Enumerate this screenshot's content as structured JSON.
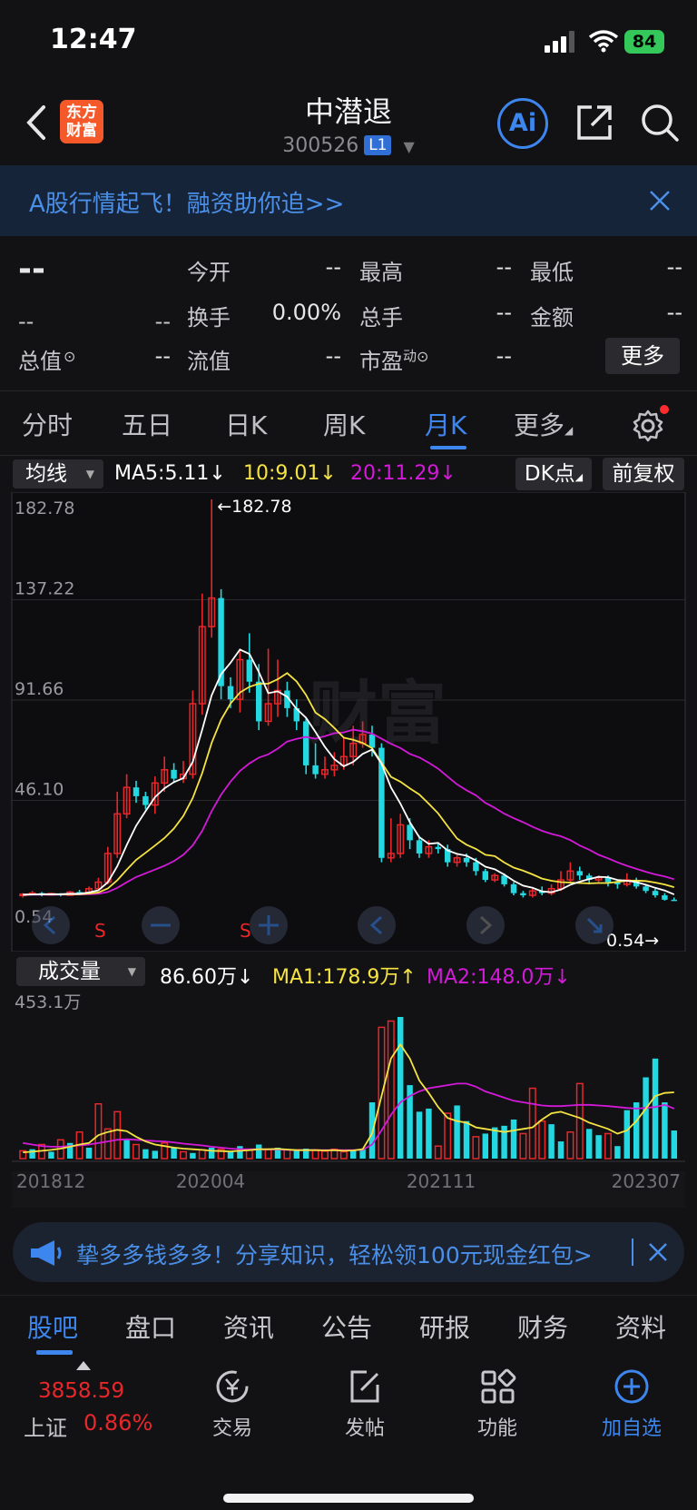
{
  "status_bar": {
    "time": "12:47",
    "battery": "84"
  },
  "header": {
    "logo_line1": "东方",
    "logo_line2": "财富",
    "title": "中潜退",
    "code": "300526",
    "level": "L1",
    "ai_label": "Ai"
  },
  "banner": {
    "text": "A股行情起飞！融资助你追>>"
  },
  "quote": {
    "price": "--",
    "change": "--",
    "change_pct": "--",
    "fields": [
      {
        "label": "今开",
        "value": "--"
      },
      {
        "label": "最高",
        "value": "--"
      },
      {
        "label": "最低",
        "value": "--"
      },
      {
        "label": "换手",
        "value": "0.00%"
      },
      {
        "label": "总手",
        "value": "--"
      },
      {
        "label": "金额",
        "value": "--"
      },
      {
        "label": "总值",
        "value": "--"
      },
      {
        "label": "流值",
        "value": "--"
      },
      {
        "label": "市盈",
        "sup": "动",
        "value": "--"
      }
    ],
    "more": "更多"
  },
  "tabs": [
    "分时",
    "五日",
    "日K",
    "周K",
    "月K",
    "更多"
  ],
  "active_tab": 4,
  "kline_toolbar": {
    "indicator": "均线",
    "ma5": "MA5:5.11↓",
    "ma10": "10:9.01↓",
    "ma20": "20:11.29↓",
    "dk": "DK点",
    "adjust": "前复权"
  },
  "kline_axis": {
    "labels": [
      "182.78",
      "137.22",
      "91.66",
      "46.10",
      "0.54"
    ],
    "max_label": "←182.78",
    "min_label": "0.54→"
  },
  "kline_markers": [
    "S",
    "S"
  ],
  "volume_toolbar": {
    "indicator": "成交量",
    "current": "86.60万↓",
    "ma1": "MA1:178.9万↑",
    "ma2": "MA2:148.0万↓"
  },
  "volume_axis": {
    "max": "453.1万"
  },
  "x_labels": [
    "201812",
    "202004",
    "202111",
    "202307"
  ],
  "colors": {
    "up": "#e8272a",
    "down": "#23d8e0",
    "ma5": "#ffffff",
    "ma10": "#f5e342",
    "ma20": "#d21ad8",
    "accent": "#3d86ee"
  },
  "promo": {
    "text": "挚多多钱多多！分享知识，轻松领100元现金红包>"
  },
  "bottom_tabs": [
    "股吧",
    "盘口",
    "资讯",
    "公告",
    "研报",
    "财务",
    "资料"
  ],
  "active_bottom_tab": 0,
  "dock": {
    "index_value": "3858.59",
    "index_name": "上证",
    "index_pct": "0.86%",
    "items": [
      "交易",
      "发帖",
      "功能",
      "加自选"
    ]
  },
  "chart_data": [
    {
      "type": "candlestick",
      "title": "",
      "ylim": [
        0.54,
        182.78
      ],
      "x_ticks": [
        "201812",
        "202004",
        "202111",
        "202307"
      ],
      "candles": [
        [
          3,
          3.5,
          2,
          4
        ],
        [
          3.5,
          4,
          3,
          5
        ],
        [
          4,
          3.2,
          2.5,
          4.5
        ],
        [
          3.2,
          3.8,
          2.8,
          4.2
        ],
        [
          3.8,
          3,
          2.5,
          4
        ],
        [
          3,
          4.5,
          2.8,
          5
        ],
        [
          4.5,
          4,
          3.5,
          5.5
        ],
        [
          4,
          6,
          3.5,
          7
        ],
        [
          6,
          9,
          5,
          11
        ],
        [
          9,
          22,
          8,
          25
        ],
        [
          22,
          40,
          20,
          50
        ],
        [
          40,
          52,
          38,
          58
        ],
        [
          52,
          48,
          45,
          55
        ],
        [
          48,
          44,
          42,
          50
        ],
        [
          44,
          54,
          40,
          57
        ],
        [
          54,
          60,
          50,
          66
        ],
        [
          60,
          56,
          54,
          63
        ],
        [
          56,
          58,
          54,
          64
        ],
        [
          58,
          90,
          56,
          96
        ],
        [
          90,
          125,
          85,
          140
        ],
        [
          125,
          138,
          120,
          182.78
        ],
        [
          138,
          98,
          92,
          142
        ],
        [
          98,
          92,
          88,
          102
        ],
        [
          92,
          110,
          86,
          115
        ],
        [
          110,
          100,
          95,
          122
        ],
        [
          100,
          82,
          78,
          108
        ],
        [
          82,
          90,
          80,
          115
        ],
        [
          90,
          96,
          84,
          110
        ],
        [
          96,
          88,
          84,
          100
        ],
        [
          88,
          82,
          78,
          92
        ],
        [
          82,
          62,
          58,
          84
        ],
        [
          62,
          58,
          56,
          72
        ],
        [
          58,
          60,
          56,
          66
        ],
        [
          60,
          62,
          57,
          68
        ],
        [
          62,
          66,
          60,
          75
        ],
        [
          66,
          72,
          62,
          80
        ],
        [
          72,
          76,
          70,
          82
        ],
        [
          76,
          70,
          66,
          80
        ],
        [
          70,
          20,
          18,
          72
        ],
        [
          20,
          22,
          18,
          38
        ],
        [
          22,
          35,
          20,
          40
        ],
        [
          35,
          28,
          24,
          38
        ],
        [
          28,
          22,
          20,
          30
        ],
        [
          22,
          25,
          20,
          28
        ],
        [
          25,
          24,
          22,
          27
        ],
        [
          24,
          18,
          16,
          26
        ],
        [
          18,
          20,
          16,
          22
        ],
        [
          20,
          18,
          16,
          22
        ],
        [
          18,
          14,
          12,
          20
        ],
        [
          14,
          10,
          9,
          15
        ],
        [
          10,
          12,
          9,
          13
        ],
        [
          12,
          8,
          7,
          13
        ],
        [
          8,
          4,
          3,
          9
        ],
        [
          4,
          3,
          2,
          5
        ],
        [
          3,
          5,
          2,
          6
        ],
        [
          5,
          4,
          3,
          7
        ],
        [
          4,
          6,
          3,
          8
        ],
        [
          6,
          10,
          5,
          14
        ],
        [
          10,
          14,
          9,
          18
        ],
        [
          14,
          12,
          10,
          16
        ],
        [
          12,
          10,
          8,
          13
        ],
        [
          10,
          11,
          9,
          12
        ],
        [
          11,
          9,
          7,
          12
        ],
        [
          9,
          8,
          6,
          10
        ],
        [
          8,
          10,
          7,
          13
        ],
        [
          10,
          7,
          6,
          11
        ],
        [
          7,
          5,
          4,
          8
        ],
        [
          5,
          3,
          2,
          6
        ],
        [
          3,
          1,
          0.6,
          4
        ],
        [
          1,
          0.8,
          0.54,
          2
        ]
      ],
      "ma5": [
        3.3,
        3.4,
        3.5,
        3.5,
        3.5,
        3.7,
        3.7,
        4.3,
        5.3,
        8.9,
        16.2,
        25.8,
        34.6,
        41.2,
        47.6,
        51.6,
        54.4,
        56.2,
        63.6,
        78.2,
        93.8,
        103.4,
        108.6,
        114.6,
        112.6,
        104.4,
        94.8,
        95.6,
        93.2,
        87.6,
        83.6,
        77.2,
        70.4,
        64.8,
        61.6,
        63.6,
        67.2,
        69.2,
        62.8,
        52.0,
        44.6,
        36.2,
        29.4,
        26.4,
        26.8,
        23.4,
        21.8,
        21.0,
        18.8,
        16.0,
        14.8,
        12.4,
        9.6,
        7.4,
        6.4,
        4.8,
        4.4,
        5.6,
        7.8,
        9.2,
        10.4,
        11.4,
        11.2,
        10.0,
        9.6,
        9.0,
        7.8,
        6.4,
        5.2,
        3.4
      ],
      "ma10": [
        3.3,
        3.4,
        3.4,
        3.4,
        3.4,
        3.5,
        3.5,
        3.8,
        4.3,
        6.1,
        9.8,
        14.6,
        19.1,
        22.3,
        25.6,
        29.0,
        33.3,
        39.0,
        47.2,
        58.5,
        72.2,
        82.7,
        90.1,
        95.1,
        97.7,
        99.1,
        99.1,
        101.1,
        103.9,
        100.1,
        94.0,
        86.0,
        83.0,
        79.0,
        74.6,
        73.6,
        72.2,
        69.8,
        63.2,
        56.8,
        54.6,
        51.6,
        48.8,
        44.6,
        40.2,
        34.4,
        28.8,
        26.0,
        24.1,
        21.4,
        20.8,
        17.9,
        15.6,
        14.2,
        12.5,
        10.6,
        9.6,
        9.0,
        8.8,
        8.6,
        8.4,
        8.6,
        8.6,
        9.1,
        9.6,
        9.7,
        9.5,
        8.8,
        7.9,
        6.7
      ],
      "ma20": [
        3.3,
        3.3,
        3.3,
        3.3,
        3.3,
        3.4,
        3.4,
        3.5,
        3.7,
        4.5,
        6.4,
        8.9,
        11.3,
        13.0,
        14.7,
        16.4,
        18.5,
        21.4,
        25.7,
        32.3,
        41.2,
        48.7,
        54.6,
        59.5,
        62.9,
        65.5,
        67.0,
        69.6,
        72.8,
        74.0,
        74.9,
        74.1,
        75.3,
        76.6,
        77.0,
        78.2,
        77.5,
        76.4,
        74.1,
        71.8,
        69.9,
        67.2,
        65.6,
        63.2,
        60.5,
        56.9,
        53.4,
        50.7,
        48.4,
        45.0,
        42.7,
        40.1,
        38.0,
        36.2,
        34.1,
        32.3,
        30.9,
        29.8,
        28.1,
        25.6,
        23.7,
        21.4,
        19.8,
        18.0,
        16.4,
        15.0,
        13.7,
        12.5,
        11.6,
        10.3
      ]
    },
    {
      "type": "bar",
      "title": "",
      "ylim": [
        0,
        453.1
      ],
      "values": [
        25,
        30,
        45,
        22,
        60,
        50,
        85,
        35,
        175,
        95,
        150,
        60,
        45,
        30,
        25,
        50,
        35,
        22,
        18,
        28,
        35,
        30,
        22,
        40,
        28,
        45,
        30,
        35,
        28,
        25,
        32,
        28,
        24,
        30,
        22,
        28,
        30,
        180,
        420,
        440,
        465,
        235,
        150,
        160,
        40,
        145,
        170,
        120,
        70,
        80,
        100,
        105,
        125,
        80,
        225,
        120,
        110,
        55,
        85,
        240,
        95,
        75,
        80,
        40,
        155,
        180,
        260,
        320,
        180,
        90
      ],
      "colors": [
        "u",
        "d",
        "u",
        "d",
        "u",
        "d",
        "u",
        "d",
        "u",
        "u",
        "u",
        "d",
        "u",
        "d",
        "d",
        "u",
        "d",
        "u",
        "d",
        "u",
        "d",
        "u",
        "d",
        "d",
        "u",
        "d",
        "u",
        "d",
        "u",
        "d",
        "d",
        "u",
        "u",
        "u",
        "u",
        "d",
        "d",
        "d",
        "u",
        "u",
        "d",
        "d",
        "d",
        "d",
        "u",
        "u",
        "d",
        "d",
        "u",
        "d",
        "d",
        "d",
        "d",
        "u",
        "u",
        "u",
        "d",
        "d",
        "u",
        "u",
        "d",
        "d",
        "u",
        "d",
        "d",
        "d",
        "d",
        "d",
        "d",
        "d"
      ],
      "ma1": [
        20,
        22,
        25,
        28,
        32,
        38,
        45,
        50,
        75,
        85,
        92,
        88,
        70,
        55,
        45,
        40,
        35,
        32,
        30,
        28,
        25,
        24,
        23,
        25,
        27,
        30,
        30,
        31,
        29,
        27,
        27,
        27,
        26,
        27,
        25,
        26,
        30,
        80,
        200,
        320,
        365,
        320,
        250,
        210,
        165,
        130,
        120,
        115,
        100,
        95,
        90,
        85,
        90,
        95,
        100,
        125,
        145,
        150,
        140,
        130,
        115,
        105,
        95,
        80,
        90,
        120,
        160,
        200,
        210,
        212
      ],
      "ma2": [
        50,
        45,
        40,
        38,
        38,
        40,
        42,
        45,
        50,
        55,
        60,
        62,
        60,
        58,
        56,
        55,
        52,
        48,
        45,
        42,
        38,
        35,
        32,
        30,
        30,
        30,
        29,
        29,
        28,
        27,
        27,
        27,
        27,
        27,
        27,
        27,
        28,
        45,
        90,
        140,
        180,
        200,
        215,
        225,
        230,
        235,
        240,
        240,
        230,
        215,
        205,
        195,
        185,
        180,
        175,
        170,
        168,
        168,
        170,
        172,
        172,
        170,
        168,
        165,
        162,
        160,
        162,
        165,
        172,
        160
      ]
    }
  ]
}
